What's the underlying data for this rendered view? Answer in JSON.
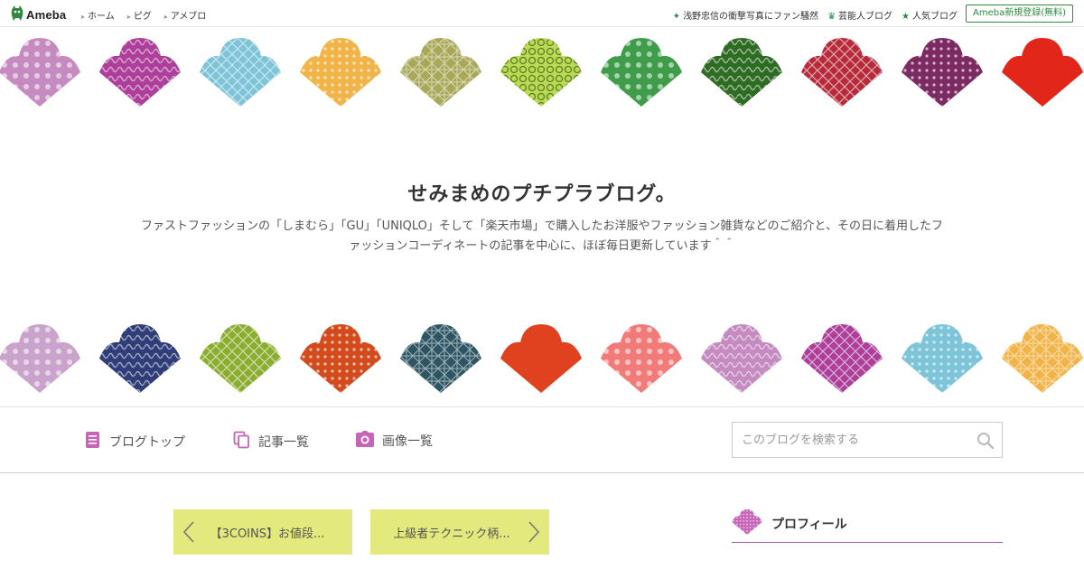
{
  "topbar": {
    "logo": "Ameba",
    "nav_left": [
      "ホーム",
      "ピグ",
      "アメブロ"
    ],
    "nav_right": [
      "浅野忠信の衝撃写真にファン騒然",
      "芸能人ブログ",
      "人気ブログ"
    ],
    "register_label": "Ameba新規登録(無料)"
  },
  "header": {
    "title": "せみまめのプチプラブログ。",
    "description_line1": "ファストファッションの「しまむら」「GU」「UNIQLO」そして「楽天市場」で購入したお洋服やファッション雑貨などのご紹介と、その日に着用したフ",
    "description_line2": "ァッションコーディネートの記事を中心に、ほぼ毎日更新しています＾＾"
  },
  "fans": {
    "top_colors": [
      "#c58bc0",
      "#ad3f9a",
      "#7dc4d9",
      "#f1b448",
      "#a9a859",
      "#b8dc51",
      "#3f9c4a",
      "#2e6c24",
      "#b72a3a",
      "#7c2b62",
      "#e2271a"
    ],
    "bottom_colors": [
      "#c9a3cb",
      "#2f3d78",
      "#8aad2f",
      "#d34b1c",
      "#2e5563",
      "#e0411e",
      "#f07b78",
      "#c58bc0",
      "#ad3f9a",
      "#7dc4d9",
      "#f1b448"
    ]
  },
  "navbar": {
    "items": [
      {
        "label": "ブログトップ",
        "icon": "document-icon"
      },
      {
        "label": "記事一覧",
        "icon": "copy-icon"
      },
      {
        "label": "画像一覧",
        "icon": "camera-icon"
      }
    ],
    "search_placeholder": "このブログを検索する",
    "accent_color": "#c764b7"
  },
  "articles": {
    "prev_label": "【3COINS】お値段...",
    "next_label": "上級者テクニック柄..."
  },
  "sidebar": {
    "profile_label": "プロフィール"
  }
}
